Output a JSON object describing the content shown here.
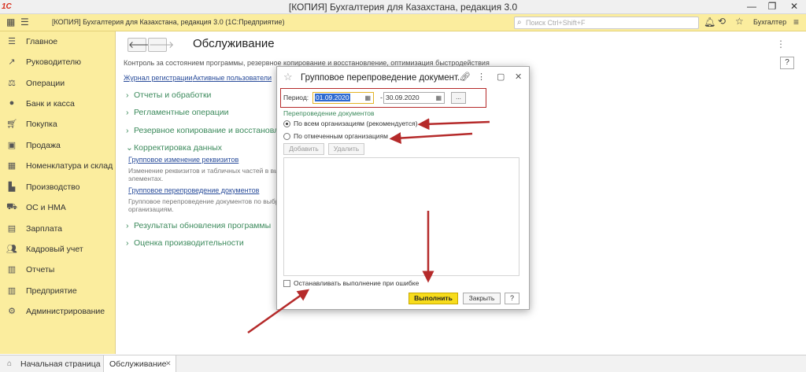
{
  "app": {
    "logo": "1С",
    "window_title": "[КОПИЯ] Бухгалтерия для Казахстана, редакция 3.0",
    "toolbar_title": "[КОПИЯ] Бухгалтерия для Казахстана, редакция 3.0  (1С:Предприятие)",
    "search_placeholder": "Поиск Ctrl+Shift+F",
    "user": "Бухгалтер"
  },
  "sidebar": {
    "items": [
      {
        "label": "Главное",
        "icon": "menu-icon"
      },
      {
        "label": "Руководителю",
        "icon": "chart-icon"
      },
      {
        "label": "Операции",
        "icon": "operations-icon"
      },
      {
        "label": "Банк и касса",
        "icon": "bank-icon"
      },
      {
        "label": "Покупка",
        "icon": "cart-icon"
      },
      {
        "label": "Продажа",
        "icon": "bag-icon"
      },
      {
        "label": "Номенклатура и склад",
        "icon": "warehouse-icon"
      },
      {
        "label": "Производство",
        "icon": "factory-icon"
      },
      {
        "label": "ОС и НМА",
        "icon": "truck-icon"
      },
      {
        "label": "Зарплата",
        "icon": "salary-icon"
      },
      {
        "label": "Кадровый учет",
        "icon": "people-icon"
      },
      {
        "label": "Отчеты",
        "icon": "reports-icon"
      },
      {
        "label": "Предприятие",
        "icon": "enterprise-icon"
      },
      {
        "label": "Администрирование",
        "icon": "gear-icon"
      }
    ]
  },
  "main": {
    "title": "Обслуживание",
    "description": "Контроль за состоянием программы, резервное копирование и восстановление, оптимизация быстродействия",
    "links": [
      "Журнал регистрации",
      "Активные пользователи"
    ],
    "sections": [
      "Отчеты и обработки",
      "Регламентные операции",
      "Резервное копирование и восстановление",
      "Корректировка данных",
      "Результаты обновления программы",
      "Оценка производительности"
    ],
    "sub": {
      "group_change_link": "Групповое изменение реквизитов",
      "group_change_text1": "Изменение реквизитов и табличных частей в выб",
      "group_change_text2": "элементах.",
      "group_repost_link": "Групповое перепроведение документов",
      "group_repost_text1": "Групповое перепроведение документов по выбра",
      "group_repost_text2": "организациям."
    },
    "help": "?"
  },
  "dialog": {
    "title": "Групповое перепроведение документ...",
    "period_label": "Период:",
    "date_from": "01.09.2020",
    "date_to": "30.09.2020",
    "dash": "-",
    "dots": "...",
    "section_label": "Перепроведение документов",
    "option_all": "По всем организациям (рекомендуется)",
    "option_marked": "По отмеченным организациям",
    "add": "Добавить",
    "delete": "Удалить",
    "stop_on_error": "Останавливать выполнение при ошибке",
    "run": "Выполнить",
    "close": "Закрыть",
    "help": "?"
  },
  "tabs": {
    "home": "Начальная страница",
    "service": "Обслуживание"
  },
  "colors": {
    "toolbar_bg": "#fbed9e",
    "accent_green": "#3c8a5c",
    "arrow_red": "#b52a2a",
    "primary_button": "#f7dc1c"
  }
}
